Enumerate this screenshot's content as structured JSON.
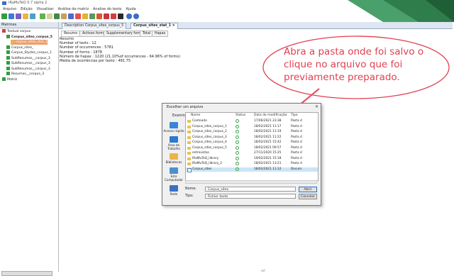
{
  "app": {
    "title": "IRaMuTeQ 0.7 alpha 2"
  },
  "menu": [
    "Arquivo",
    "Edição",
    "Visualizar",
    "Análise de matriz",
    "Analise do texto",
    "Ajuda"
  ],
  "left_panel": {
    "header": "Matrices",
    "tree": [
      {
        "label": "Textual corpus",
        "level": 0
      },
      {
        "label": "Corpus_sites_corpus_5",
        "level": 1,
        "bold": true
      },
      {
        "label": "corpus_sites_stat_1",
        "level": 2,
        "selected": true
      },
      {
        "label": "Corpus_sites_",
        "level": 1
      },
      {
        "label": "Corpus_Stydes_corpus_1",
        "level": 1
      },
      {
        "label": "SubResumos__corpus_3",
        "level": 1
      },
      {
        "label": "SubResumos__corpus_3",
        "level": 1
      },
      {
        "label": "SubResumos__corpus_3",
        "level": 1
      },
      {
        "label": "Resumos__corpus_3",
        "level": 1
      },
      {
        "label": "Matriz",
        "level": 0
      }
    ]
  },
  "doc_tabs": [
    "Description Corpus_sites_corpus_5",
    "Corpus_sites_stat_1 ×"
  ],
  "summary_tabs": [
    "Resumo ×",
    "Actives forms",
    "Supplementary forms",
    "Total",
    "Hapax"
  ],
  "summary": {
    "lines": [
      "Resumo",
      "Number of texts : 12",
      "Number of occurrences : 5781",
      "Number of forms : 1878",
      "Número de hapax : 1220 (21.10%of occurrences - 64.96% of forms)",
      "Média de ocorrências por texto : 481.75"
    ]
  },
  "callout": {
    "text": "Abra a pasta onde foi salvo o clique no arquivo que foi previamente preparado.",
    "color": "#e04050"
  },
  "dialog": {
    "title": "Escolher um arquivo",
    "examinar_label": "Examinar:",
    "examinar_value": "Encontro",
    "places": [
      "Acesso rápido",
      "Área de Trabalho",
      "Bibliotecas",
      "Este Computador",
      "Rede"
    ],
    "columns": [
      "Nome",
      "Status",
      "Data de modificação",
      "Tipo"
    ],
    "files": [
      {
        "name": "Conteúdo",
        "date": "17/06/2021 23:38",
        "type": "Pasta d",
        "kind": "folder"
      },
      {
        "name": "Corpus_sites_corpus_1",
        "date": "18/02/2021 11:17",
        "type": "Pasta d",
        "kind": "folder"
      },
      {
        "name": "Corpus_sites_corpus_2",
        "date": "18/02/2021 11:19",
        "type": "Pasta d",
        "kind": "folder"
      },
      {
        "name": "Corpus_sites_corpus_3",
        "date": "18/02/2021 11:22",
        "type": "Pasta d",
        "kind": "folder"
      },
      {
        "name": "Corpus_sites_corpus_4",
        "date": "18/02/2021 15:42",
        "type": "Pasta d",
        "kind": "folder"
      },
      {
        "name": "Corpus_sites_corpus_5",
        "date": "18/02/2021 09:57",
        "type": "Pasta d",
        "kind": "folder"
      },
      {
        "name": "entrevistas",
        "date": "27/11/2020 15:25",
        "type": "Pasta d",
        "kind": "folder"
      },
      {
        "name": "IRaMuTeQ_library",
        "date": "19/02/2021 15:18",
        "type": "Pasta d",
        "kind": "folder"
      },
      {
        "name": "IRaMuTeQ_library_2",
        "date": "18/02/2021 13:21",
        "type": "Pasta d",
        "kind": "folder"
      },
      {
        "name": "Corpus_sites",
        "date": "18/02/2021 11:12",
        "type": "Docum",
        "kind": "doc",
        "selected": true
      }
    ],
    "nome_label": "Nome:",
    "nome_value": "Corpus_sites",
    "tipo_label": "Tipo:",
    "tipo_value": "Fichier texte",
    "open_button": "Abrir",
    "cancel_button": "Cancelar"
  },
  "page_marker": "ref"
}
